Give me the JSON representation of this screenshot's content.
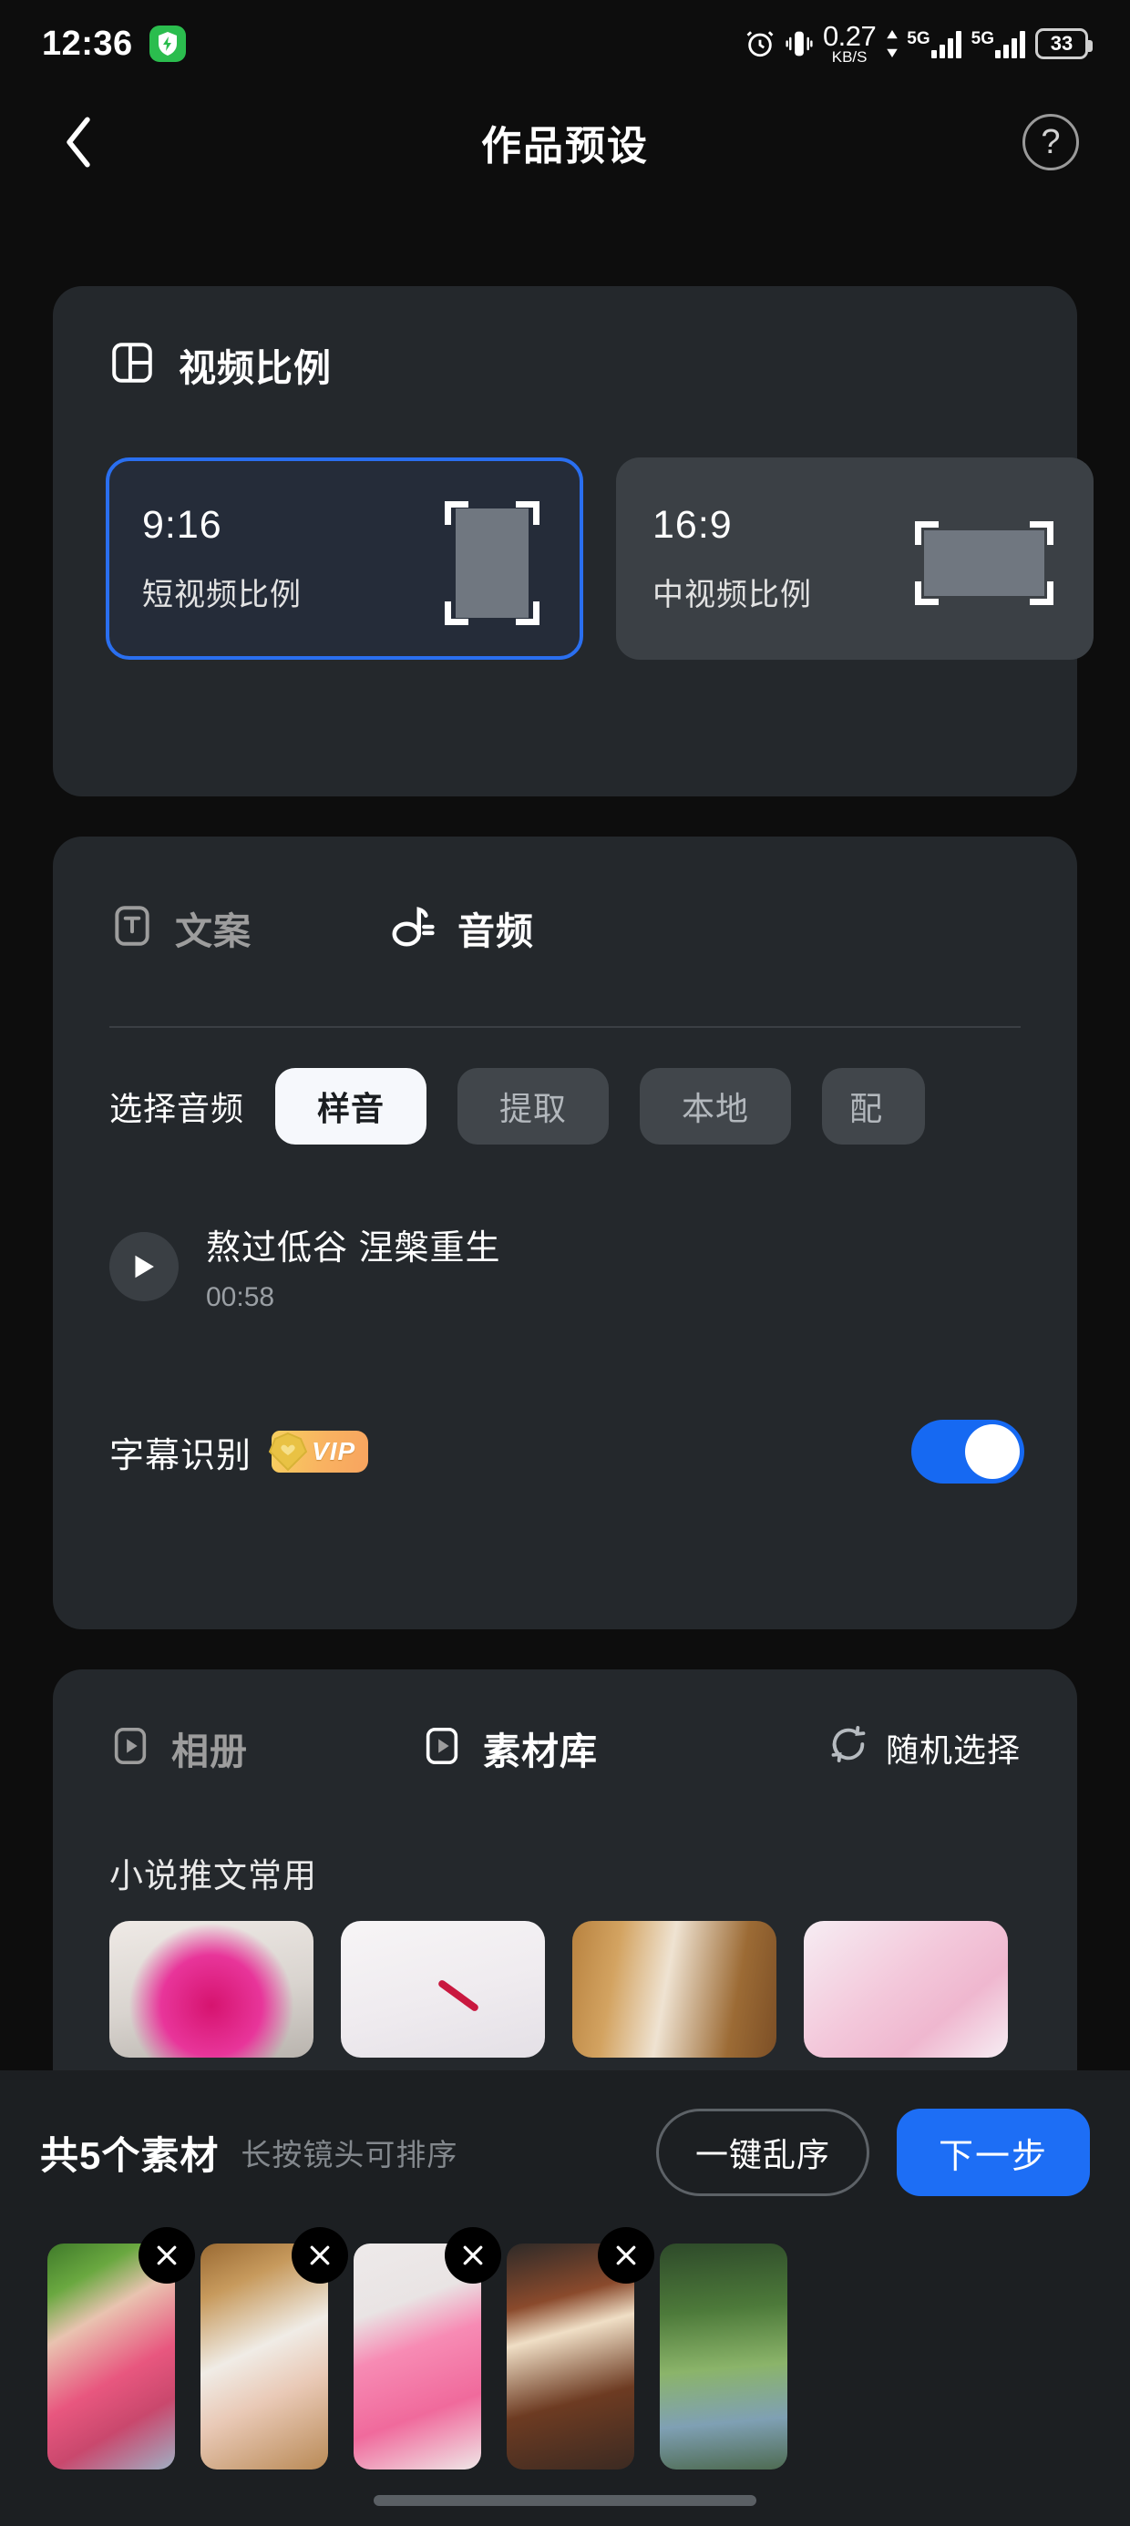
{
  "status_bar": {
    "time": "12:36",
    "charge_badge_icon": "shield-bolt-icon",
    "alarm_icon": "alarm-clock-icon",
    "vibrate_icon": "vibrate-icon",
    "net_speed_value": "0.27",
    "net_speed_unit": "KB/S",
    "sim1_network": "5G",
    "sim2_network": "5G",
    "battery_percent": "33"
  },
  "header": {
    "back_icon": "chevron-left-icon",
    "title": "作品预设",
    "help_label": "?"
  },
  "video_ratio": {
    "icon": "layout-panel-icon",
    "title": "视频比例",
    "options": [
      {
        "ratio": "9:16",
        "desc": "短视频比例",
        "selected": true,
        "orientation": "portrait"
      },
      {
        "ratio": "16:9",
        "desc": "中视频比例",
        "selected": false,
        "orientation": "landscape"
      }
    ]
  },
  "audio_section": {
    "tabs": [
      {
        "label": "文案",
        "icon": "text-box-icon",
        "active": false
      },
      {
        "label": "音频",
        "icon": "music-note-icon",
        "active": true
      }
    ],
    "select_label": "选择音频",
    "chips": [
      {
        "label": "样音",
        "selected": true
      },
      {
        "label": "提取",
        "selected": false
      },
      {
        "label": "本地",
        "selected": false
      },
      {
        "label": "配",
        "selected": false
      }
    ],
    "track": {
      "play_icon": "play-icon",
      "title": "熬过低谷 涅槃重生",
      "duration": "00:58"
    },
    "subtitle_row": {
      "label": "字幕识别",
      "badge": "VIP",
      "badge_icon": "vip-diamond-icon",
      "toggle_on": true
    }
  },
  "material_section": {
    "tabs": [
      {
        "label": "相册",
        "icon": "play-square-icon",
        "active": false
      },
      {
        "label": "素材库",
        "icon": "play-square-icon",
        "active": true
      }
    ],
    "random_label": "随机选择",
    "random_icon": "refresh-shuffle-icon",
    "category_title": "小说推文常用",
    "thumbnails": [
      "thumb-pink-clay",
      "thumb-white-cream",
      "thumb-wood-hands",
      "thumb-pink-pastel"
    ]
  },
  "bottom_bar": {
    "count_text": "共5个素材",
    "hint_text": "长按镜头可排序",
    "shuffle_button": "一键乱序",
    "next_button": "下一步",
    "clips": [
      {
        "name": "clip-pink-soap",
        "delete_icon": "close-icon"
      },
      {
        "name": "clip-white-ball",
        "delete_icon": "close-icon"
      },
      {
        "name": "clip-pink-cone",
        "delete_icon": "close-icon"
      },
      {
        "name": "clip-brown-sponge",
        "delete_icon": "close-icon"
      },
      {
        "name": "clip-green-river",
        "delete_icon": "close-icon"
      }
    ]
  },
  "colors": {
    "accent_blue": "#1d6ef5",
    "card_bg": "#24282c",
    "page_bg": "#0d0d0d",
    "vip_gold": "#f7c85e"
  }
}
